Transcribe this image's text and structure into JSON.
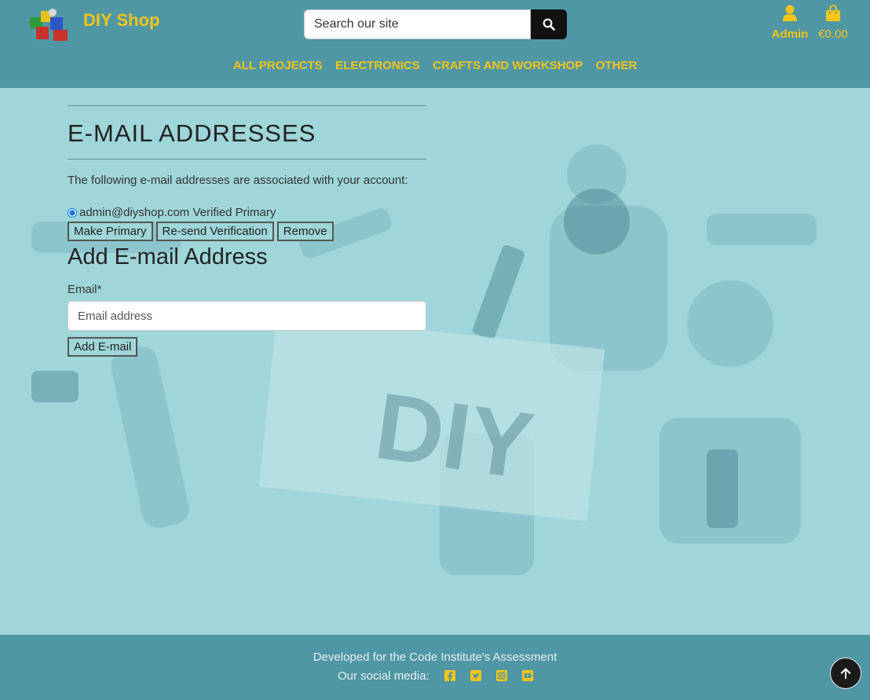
{
  "header": {
    "brand": "DIY Shop",
    "search_placeholder": "Search our site",
    "account_label": "Admin",
    "cart_total": "€0.00",
    "nav": [
      "ALL PROJECTS",
      "ELECTRONICS",
      "CRAFTS AND WORKSHOP",
      "OTHER"
    ],
    "accent_color": "#f5c518",
    "bar_color": "#4f97a5"
  },
  "background": {
    "art_text": "DIY"
  },
  "main": {
    "title": "E-MAIL ADDRESSES",
    "intro": "The following e-mail addresses are associated with your account:",
    "emails": [
      {
        "address": "admin@diyshop.com",
        "status": "Verified Primary",
        "selected": true
      }
    ],
    "buttons": {
      "make_primary": "Make Primary",
      "resend": "Re-send Verification",
      "remove": "Remove"
    },
    "add_title": "Add E-mail Address",
    "email_label": "Email*",
    "email_placeholder": "Email address",
    "add_button": "Add E-mail"
  },
  "footer": {
    "credit": "Developed for the Code Institute's Assessment",
    "social_label": "Our social media:",
    "social_icons": [
      "facebook-icon",
      "twitter-icon",
      "instagram-icon",
      "youtube-icon"
    ]
  }
}
